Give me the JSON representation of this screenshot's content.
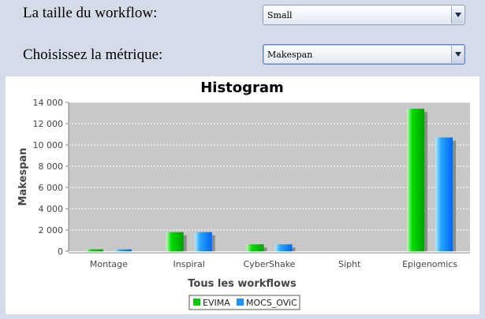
{
  "form": {
    "size_label": "La taille du workflow:",
    "size_value": "Small",
    "metric_label": "Choisissez la métrique:",
    "metric_value": "Makespan"
  },
  "icons": {
    "dropdown": "chevron-down-icon"
  },
  "colors": {
    "plot_background": "#c8c8c8",
    "evima": "#00cc00",
    "mocs_ovic": "#1e90ff",
    "page_background": "#d6dbe9"
  },
  "chart_data": {
    "type": "bar",
    "title": "Histogram",
    "xlabel": "Tous les workflows",
    "ylabel": "Makespan",
    "categories": [
      "Montage",
      "Inspiral",
      "CyberShake",
      "Sipht",
      "Epigenomics"
    ],
    "series": [
      {
        "name": "EVIMA",
        "values": [
          180,
          1800,
          650,
          0,
          13400
        ]
      },
      {
        "name": "MOCS_OViC",
        "values": [
          180,
          1800,
          650,
          0,
          10700
        ]
      }
    ],
    "ylim": [
      0,
      14000
    ],
    "yticks": [
      0,
      2000,
      4000,
      6000,
      8000,
      10000,
      12000,
      14000
    ],
    "ytick_labels": [
      "0",
      "2 000",
      "4 000",
      "6 000",
      "8 000",
      "10 000",
      "12 000",
      "14 000"
    ],
    "grid": true,
    "legend_position": "bottom"
  }
}
